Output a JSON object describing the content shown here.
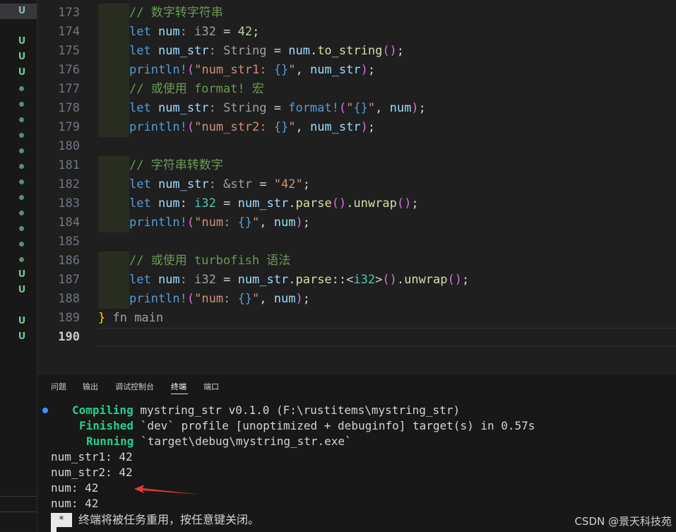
{
  "explorer": {
    "marks": [
      "U",
      "U",
      "U",
      "U",
      "●",
      "●",
      "●",
      "●",
      "●",
      "●",
      "●",
      "●",
      "●",
      "●",
      "●",
      "●",
      "U",
      "U",
      "U",
      "U"
    ]
  },
  "editor": {
    "lines": [
      {
        "n": "173",
        "tokens": [
          {
            "c": "cm",
            "t": "// 数字转字符串"
          }
        ]
      },
      {
        "n": "174",
        "tokens": [
          {
            "c": "kw",
            "t": "let "
          },
          {
            "c": "var",
            "t": "num"
          },
          {
            "c": "hint",
            "t": ": i32"
          },
          {
            "c": "op",
            "t": " = "
          },
          {
            "c": "nm",
            "t": "42"
          },
          {
            "c": "op",
            "t": ";"
          }
        ]
      },
      {
        "n": "175",
        "tokens": [
          {
            "c": "kw",
            "t": "let "
          },
          {
            "c": "var",
            "t": "num_str"
          },
          {
            "c": "hint",
            "t": ": String"
          },
          {
            "c": "op",
            "t": " = "
          },
          {
            "c": "var",
            "t": "num"
          },
          {
            "c": "op",
            "t": "."
          },
          {
            "c": "fnc",
            "t": "to_string"
          },
          {
            "c": "p2",
            "t": "()"
          },
          {
            "c": "op",
            "t": ";"
          }
        ]
      },
      {
        "n": "176",
        "tokens": [
          {
            "c": "mac",
            "t": "println!"
          },
          {
            "c": "p2",
            "t": "("
          },
          {
            "c": "st",
            "t": "\"num_str1: "
          },
          {
            "c": "kw",
            "t": "{}"
          },
          {
            "c": "st",
            "t": "\""
          },
          {
            "c": "op",
            "t": ", "
          },
          {
            "c": "var",
            "t": "num_str"
          },
          {
            "c": "p2",
            "t": ")"
          },
          {
            "c": "op",
            "t": ";"
          }
        ]
      },
      {
        "n": "177",
        "tokens": [
          {
            "c": "cm",
            "t": "// 或使用 format! 宏"
          }
        ]
      },
      {
        "n": "178",
        "tokens": [
          {
            "c": "kw",
            "t": "let "
          },
          {
            "c": "var",
            "t": "num_str"
          },
          {
            "c": "hint",
            "t": ": String"
          },
          {
            "c": "op",
            "t": " = "
          },
          {
            "c": "mac",
            "t": "format!"
          },
          {
            "c": "p2",
            "t": "("
          },
          {
            "c": "st",
            "t": "\""
          },
          {
            "c": "kw",
            "t": "{}"
          },
          {
            "c": "st",
            "t": "\""
          },
          {
            "c": "op",
            "t": ", "
          },
          {
            "c": "var",
            "t": "num"
          },
          {
            "c": "p2",
            "t": ")"
          },
          {
            "c": "op",
            "t": ";"
          }
        ]
      },
      {
        "n": "179",
        "tokens": [
          {
            "c": "mac",
            "t": "println!"
          },
          {
            "c": "p2",
            "t": "("
          },
          {
            "c": "st",
            "t": "\"num_str2: "
          },
          {
            "c": "kw",
            "t": "{}"
          },
          {
            "c": "st",
            "t": "\""
          },
          {
            "c": "op",
            "t": ", "
          },
          {
            "c": "var",
            "t": "num_str"
          },
          {
            "c": "p2",
            "t": ")"
          },
          {
            "c": "op",
            "t": ";"
          }
        ]
      },
      {
        "n": "180",
        "tokens": []
      },
      {
        "n": "181",
        "tokens": [
          {
            "c": "cm",
            "t": "// 字符串转数字"
          }
        ]
      },
      {
        "n": "182",
        "tokens": [
          {
            "c": "kw",
            "t": "let "
          },
          {
            "c": "var",
            "t": "num_str"
          },
          {
            "c": "hint",
            "t": ": &str"
          },
          {
            "c": "op",
            "t": " = "
          },
          {
            "c": "st",
            "t": "\"42\""
          },
          {
            "c": "op",
            "t": ";"
          }
        ]
      },
      {
        "n": "183",
        "tokens": [
          {
            "c": "kw",
            "t": "let "
          },
          {
            "c": "var",
            "t": "num"
          },
          {
            "c": "op",
            "t": ": "
          },
          {
            "c": "ty",
            "t": "i32"
          },
          {
            "c": "op",
            "t": " = "
          },
          {
            "c": "var",
            "t": "num_str"
          },
          {
            "c": "op",
            "t": "."
          },
          {
            "c": "fnc",
            "t": "parse"
          },
          {
            "c": "p2",
            "t": "()"
          },
          {
            "c": "op",
            "t": "."
          },
          {
            "c": "fnc",
            "t": "unwrap"
          },
          {
            "c": "p2",
            "t": "()"
          },
          {
            "c": "op",
            "t": ";"
          }
        ]
      },
      {
        "n": "184",
        "tokens": [
          {
            "c": "mac",
            "t": "println!"
          },
          {
            "c": "p2",
            "t": "("
          },
          {
            "c": "st",
            "t": "\"num: "
          },
          {
            "c": "kw",
            "t": "{}"
          },
          {
            "c": "st",
            "t": "\""
          },
          {
            "c": "op",
            "t": ", "
          },
          {
            "c": "var",
            "t": "num"
          },
          {
            "c": "p2",
            "t": ")"
          },
          {
            "c": "op",
            "t": ";"
          }
        ]
      },
      {
        "n": "185",
        "tokens": []
      },
      {
        "n": "186",
        "tokens": [
          {
            "c": "cm",
            "t": "// 或使用 turbofish 语法"
          }
        ]
      },
      {
        "n": "187",
        "tokens": [
          {
            "c": "kw",
            "t": "let "
          },
          {
            "c": "var",
            "t": "num"
          },
          {
            "c": "hint",
            "t": ": i32"
          },
          {
            "c": "op",
            "t": " = "
          },
          {
            "c": "var",
            "t": "num_str"
          },
          {
            "c": "op",
            "t": "."
          },
          {
            "c": "fnc",
            "t": "parse"
          },
          {
            "c": "op",
            "t": "::<"
          },
          {
            "c": "ty",
            "t": "i32"
          },
          {
            "c": "op",
            "t": ">"
          },
          {
            "c": "p2",
            "t": "()"
          },
          {
            "c": "op",
            "t": "."
          },
          {
            "c": "fnc",
            "t": "unwrap"
          },
          {
            "c": "p2",
            "t": "()"
          },
          {
            "c": "op",
            "t": ";"
          }
        ]
      },
      {
        "n": "188",
        "tokens": [
          {
            "c": "mac",
            "t": "println!"
          },
          {
            "c": "p2",
            "t": "("
          },
          {
            "c": "st",
            "t": "\"num: "
          },
          {
            "c": "kw",
            "t": "{}"
          },
          {
            "c": "st",
            "t": "\""
          },
          {
            "c": "op",
            "t": ", "
          },
          {
            "c": "var",
            "t": "num"
          },
          {
            "c": "p2",
            "t": ")"
          },
          {
            "c": "op",
            "t": ";"
          }
        ]
      },
      {
        "n": "189",
        "tokens": [
          {
            "c": "p1",
            "t": "}"
          },
          {
            "c": "hint",
            "t": " fn main"
          }
        ]
      },
      {
        "n": "190",
        "tokens": []
      }
    ],
    "active_line": "190"
  },
  "panel": {
    "tabs": [
      "问题",
      "输出",
      "调试控制台",
      "终端",
      "端口"
    ],
    "active_tab": "终端",
    "terminal": {
      "compiling_label": "Compiling",
      "compiling_text": " mystring_str v0.1.0 (F:\\rustitems\\mystring_str)",
      "finished_label": "Finished",
      "finished_text": " `dev` profile [unoptimized + debuginfo] target(s) in 0.57s",
      "running_label": "Running",
      "running_text": " `target\\debug\\mystring_str.exe`",
      "output": [
        "num_str1: 42",
        "num_str2: 42",
        "num: 42",
        "num: 42"
      ],
      "star": "*",
      "notice": "终端将被任务重用，按任意键关闭。"
    },
    "arrow_color": "#e53935"
  },
  "watermark": "CSDN @景天科技苑"
}
